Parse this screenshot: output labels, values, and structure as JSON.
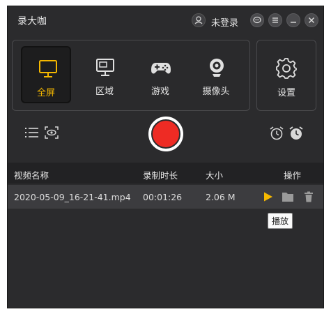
{
  "app": {
    "title": "录大咖"
  },
  "titlebar": {
    "login_label": "未登录",
    "buttons": [
      "chat-icon",
      "menu-icon",
      "minimize-icon",
      "close-icon"
    ]
  },
  "modes": {
    "items": [
      {
        "label": "全屏",
        "icon": "monitor-icon",
        "active": true
      },
      {
        "label": "区域",
        "icon": "region-icon",
        "active": false
      },
      {
        "label": "游戏",
        "icon": "gamepad-icon",
        "active": false
      },
      {
        "label": "摄像头",
        "icon": "webcam-icon",
        "active": false
      }
    ],
    "settings_label": "设置"
  },
  "controls": {
    "left_icons": [
      "list-icon",
      "preview-eye-icon"
    ],
    "record": "record-button",
    "right_icons": [
      "alarm-clock-icon",
      "timer-clock-icon"
    ]
  },
  "table": {
    "headers": [
      "视频名称",
      "录制时长",
      "大小",
      "操作"
    ],
    "rows": [
      {
        "name": "2020-05-09_16-21-41.mp4",
        "duration": "00:01:26",
        "size": "2.06 M"
      }
    ],
    "row_actions": [
      "play-icon",
      "folder-icon",
      "trash-icon"
    ],
    "tooltip": "播放"
  },
  "colors": {
    "accent": "#f5b800",
    "record": "#ee2b24",
    "background": "#2b2b2d"
  }
}
